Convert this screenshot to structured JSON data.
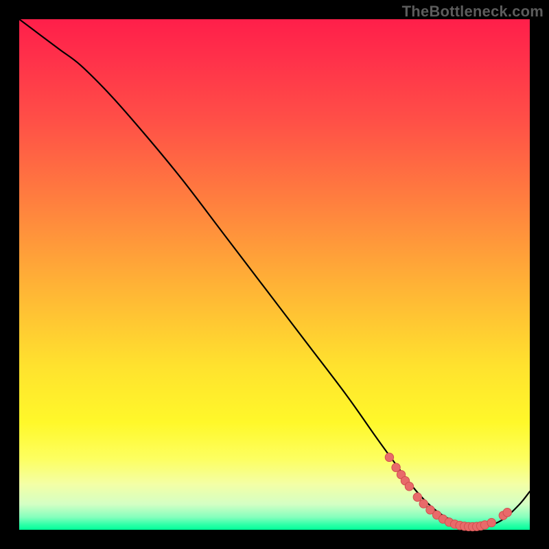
{
  "watermark": "TheBottleneck.com",
  "colors": {
    "frame_bg": "#000000",
    "curve_stroke": "#000000",
    "marker_fill": "#e86a6a",
    "marker_stroke": "#d14f4f"
  },
  "chart_data": {
    "type": "line",
    "title": "",
    "xlabel": "",
    "ylabel": "",
    "xlim": [
      0,
      100
    ],
    "ylim": [
      0,
      100
    ],
    "series": [
      {
        "name": "bottleneck-curve",
        "x": [
          0,
          4,
          8,
          12,
          18,
          25,
          32,
          40,
          48,
          56,
          64,
          70,
          74,
          77,
          80,
          83,
          86,
          89,
          92,
          95,
          98,
          100
        ],
        "y": [
          100,
          97,
          94,
          91,
          85,
          77,
          68.5,
          58,
          47.5,
          37,
          26.5,
          18,
          12.5,
          8.5,
          5.2,
          2.8,
          1.4,
          0.6,
          0.8,
          2.2,
          5.0,
          7.5
        ]
      }
    ],
    "markers": [
      {
        "x": 72.5,
        "y": 14.2
      },
      {
        "x": 73.8,
        "y": 12.2
      },
      {
        "x": 74.8,
        "y": 10.8
      },
      {
        "x": 75.6,
        "y": 9.6
      },
      {
        "x": 76.4,
        "y": 8.5
      },
      {
        "x": 78.0,
        "y": 6.4
      },
      {
        "x": 79.2,
        "y": 5.1
      },
      {
        "x": 80.5,
        "y": 3.9
      },
      {
        "x": 81.8,
        "y": 2.9
      },
      {
        "x": 83.0,
        "y": 2.1
      },
      {
        "x": 84.2,
        "y": 1.5
      },
      {
        "x": 85.3,
        "y": 1.1
      },
      {
        "x": 86.3,
        "y": 0.85
      },
      {
        "x": 87.2,
        "y": 0.7
      },
      {
        "x": 88.0,
        "y": 0.62
      },
      {
        "x": 88.8,
        "y": 0.6
      },
      {
        "x": 89.6,
        "y": 0.64
      },
      {
        "x": 90.4,
        "y": 0.75
      },
      {
        "x": 91.2,
        "y": 0.95
      },
      {
        "x": 92.5,
        "y": 1.4
      },
      {
        "x": 94.8,
        "y": 2.8
      },
      {
        "x": 95.6,
        "y": 3.4
      }
    ]
  }
}
